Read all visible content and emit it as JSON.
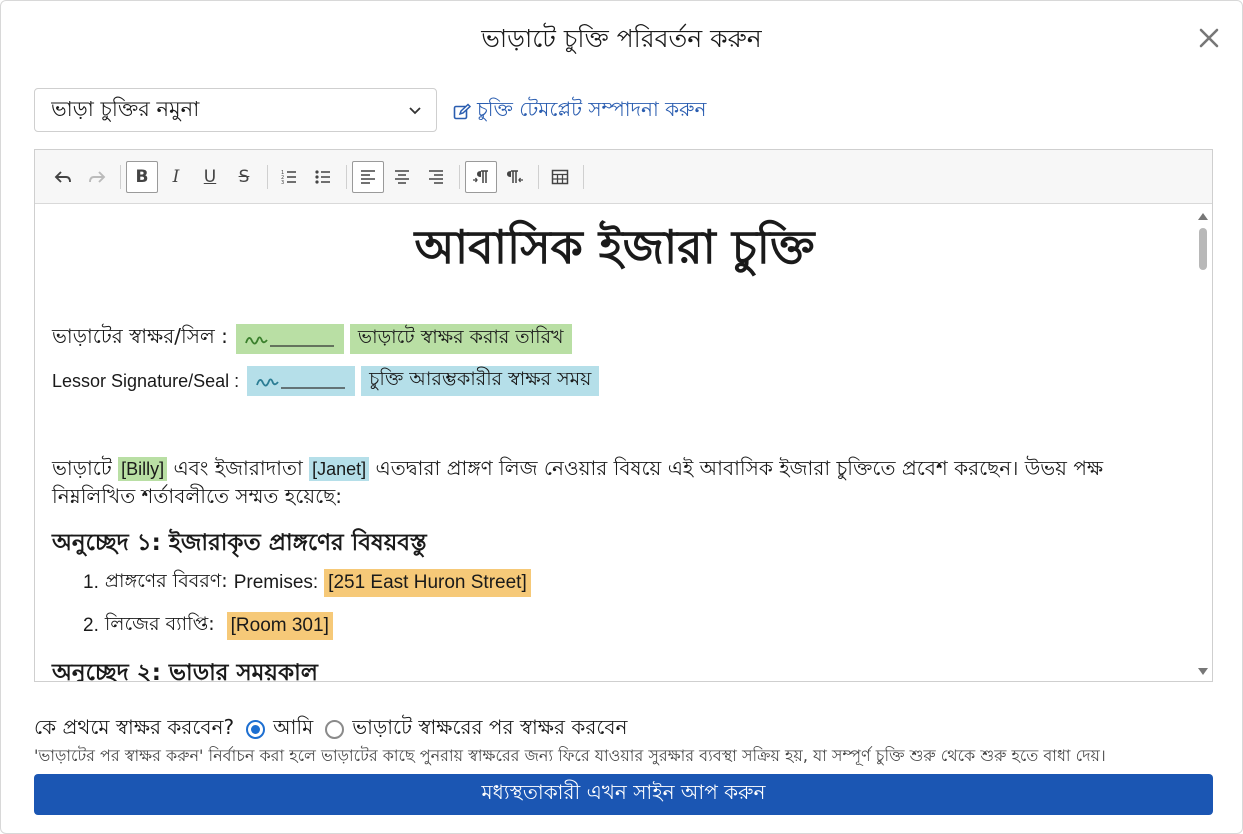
{
  "modal": {
    "title": "ভাড়াটে চুক্তি পরিবর্তন করুন"
  },
  "template_select": {
    "value": "ভাড়া চুক্তির নমুনা"
  },
  "edit_template_link": "চুক্তি টেমপ্লেট সম্পাদনা করুন",
  "toolbar": {
    "bold": "B",
    "italic": "I",
    "underline": "U",
    "strike": "S"
  },
  "document": {
    "title": "আবাসিক ইজারা চুক্তি",
    "tenant_sig_label": "ভাড়াটের স্বাক্ষর/সিল :",
    "tenant_date_tag": "ভাড়াটে স্বাক্ষর করার তারিখ",
    "lessor_sig_label": "Lessor Signature/Seal :",
    "lessor_time_tag": "চুক্তি আরম্ভকারীর স্বাক্ষর সময়",
    "intro": {
      "part1": "ভাড়াটে",
      "tenant": "[Billy]",
      "part2": "এবং ইজারাদাতা",
      "lessor": "[Janet]",
      "part3": "এতদ্বারা প্রাঙ্গণ লিজ নেওয়ার বিষয়ে এই আবাসিক ইজারা চুক্তিতে প্রবেশ করছেন। উভয় পক্ষ নিম্নলিখিত শর্তাবলীতে সম্মত হয়েছে:"
    },
    "section1_heading": "অনুচ্ছেদ ১: ইজারাকৃত প্রাঙ্গণের বিষয়বস্তু",
    "items": [
      {
        "num": "1.",
        "label": "প্রাঙ্গণের বিবরণ:",
        "latin": "Premises:",
        "value": "[251 East Huron Street]"
      },
      {
        "num": "2.",
        "label": "লিজের ব্যাপ্তি:",
        "latin": "",
        "value": "[Room 301]"
      }
    ],
    "section2_heading": "অনুচ্ছেদ ২: ভাড়ার সময়কাল"
  },
  "signer": {
    "question": "কে প্রথমে স্বাক্ষর করবেন?",
    "option_me": "আমি",
    "option_after": "ভাড়াটে স্বাক্ষরের পর স্বাক্ষর করবেন",
    "selected": "আমি",
    "hint": "'ভাড়াটের পর স্বাক্ষর করুন' নির্বাচন করা হলে ভাড়াটের কাছে পুনরায় স্বাক্ষরের জন্য ফিরে যাওয়ার সুরক্ষার ব্যবস্থা সক্রিয় হয়, যা সম্পূর্ণ চুক্তি শুরু থেকে শুরু হতে বাধা দেয়।"
  },
  "submit_button": "মধ্যস্থতাকারী এখন সাইন আপ করুন",
  "colors": {
    "primary": "#1b56b3",
    "link": "#2a5db0",
    "tag_green": "#b9dfa4",
    "tag_blue": "#b5dfe9",
    "tag_orange": "#f6c978"
  }
}
